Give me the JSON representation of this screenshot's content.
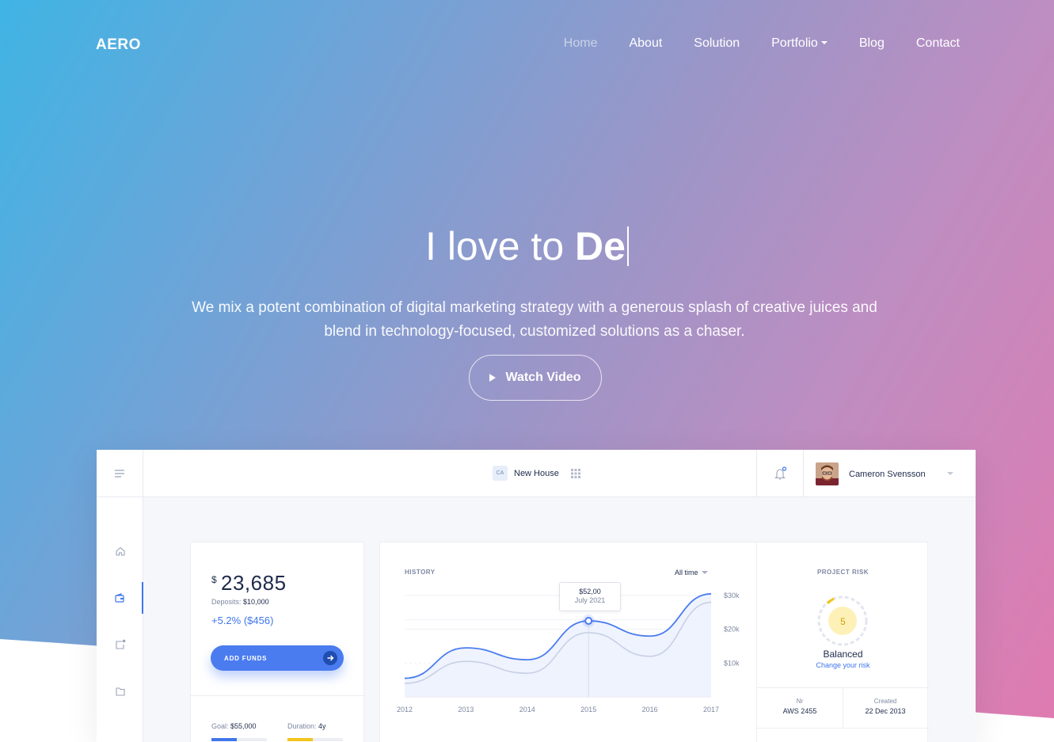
{
  "brand": {
    "logo": "AERO"
  },
  "nav": {
    "items": [
      {
        "label": "Home",
        "active": true
      },
      {
        "label": "About"
      },
      {
        "label": "Solution"
      },
      {
        "label": "Portfolio",
        "dropdown": true
      },
      {
        "label": "Blog"
      },
      {
        "label": "Contact"
      }
    ]
  },
  "hero": {
    "headline_light": "I love to",
    "headline_bold": "De",
    "subtitle": "We mix a potent combination of digital marketing strategy with a generous splash of creative juices and blend in technology-focused, customized solutions as a chaser.",
    "cta": "Watch Video"
  },
  "dashboard": {
    "topbar": {
      "project_badge": "CA",
      "project_name": "New House",
      "user_name": "Cameron Svensson"
    },
    "sidebar_icons": [
      "home-icon",
      "wallet-icon",
      "share-icon",
      "folder-icon"
    ],
    "balance": {
      "currency": "$",
      "amount": "23,685",
      "deposits_label": "Deposits:",
      "deposits_value": "$10,000",
      "change": "+5.2% ($456)",
      "button": "ADD FUNDS",
      "goal_label": "Goal:",
      "goal_value": "$55,000",
      "duration_label": "Duration:",
      "duration_value": "4y",
      "goal_progress": 0.45,
      "duration_progress": 0.45
    },
    "history": {
      "title": "HISTORY",
      "filter": "All time",
      "tooltip_value": "$52,00",
      "tooltip_date": "July 2021"
    },
    "risk": {
      "title": "PROJECT RISK",
      "score": "5",
      "label": "Balanced",
      "link": "Change your risk",
      "nr_label": "Nr",
      "nr_value": "AWS 2455",
      "created_label": "Created",
      "created_value": "22 Dec 2013"
    }
  },
  "colors": {
    "accent": "#3f76ec",
    "risk": "#f3c41b",
    "text": "#1e2a4a"
  },
  "chart_data": {
    "type": "line",
    "x": [
      "2012",
      "2013",
      "2014",
      "2015",
      "2016",
      "2017"
    ],
    "y_ticks": [
      "$10k",
      "$20k",
      "$30k"
    ],
    "ylim": [
      0,
      34
    ],
    "series": [
      {
        "values": [
          5.5,
          14.5,
          11,
          22.5,
          18,
          30.5
        ]
      },
      {
        "values": [
          4,
          10.5,
          7,
          19,
          12,
          28
        ]
      }
    ],
    "grid": true
  }
}
